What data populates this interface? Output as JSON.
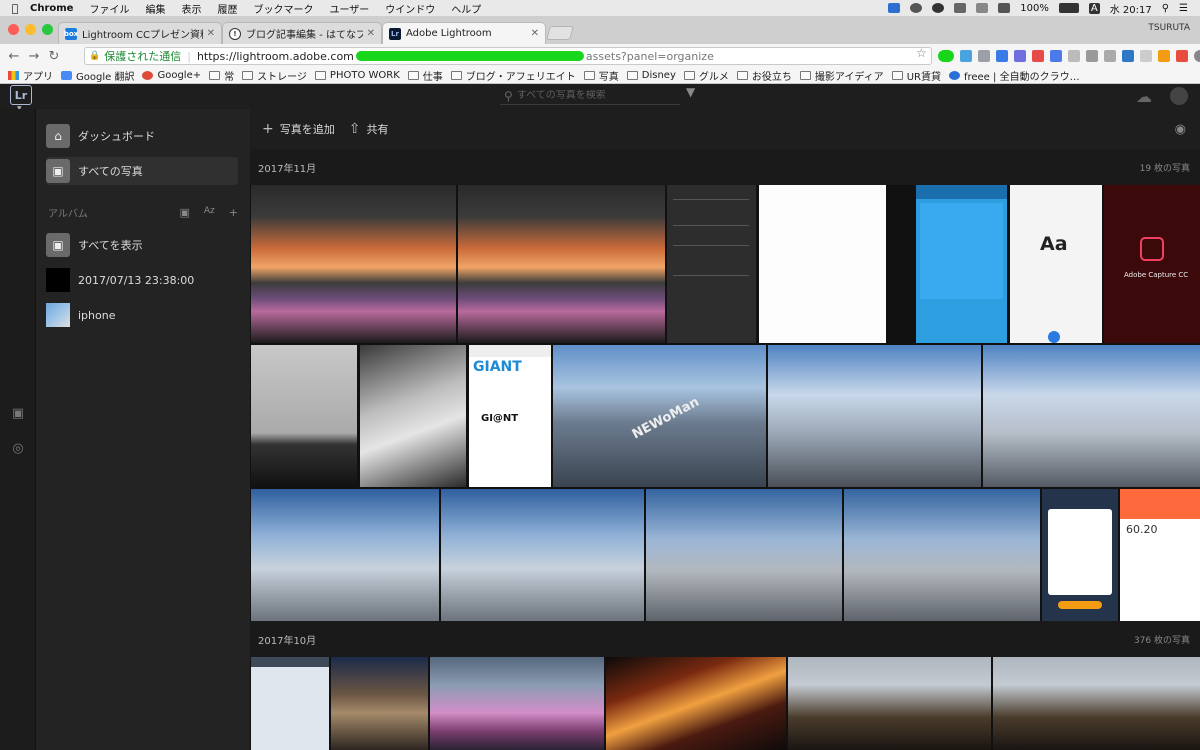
{
  "menubar": {
    "app": "Chrome",
    "items": [
      "ファイル",
      "編集",
      "表示",
      "履歴",
      "ブックマーク",
      "ユーザー",
      "ウインドウ",
      "ヘルプ"
    ],
    "battery": "100%",
    "input_mode": "A",
    "clock": "水 20:17"
  },
  "browser": {
    "tabs": [
      {
        "label": "Lightroom CCプレゼン資料.pdf",
        "favicon": "box",
        "active": false
      },
      {
        "label": "ブログ記事編集 - はてなブログ",
        "favicon": "hatena",
        "active": false
      },
      {
        "label": "Adobe Lightroom",
        "favicon": "Lr",
        "active": true
      }
    ],
    "profile_name": "TSURUTA",
    "address": {
      "secure_label": "保護された通信",
      "host": "https://lightroom.adobe.com",
      "path": "assets?panel=organize"
    },
    "bookmarks": [
      {
        "label": "アプリ",
        "icon": "apps-icon"
      },
      {
        "label": "Google 翻訳",
        "icon": "google-translate-icon"
      },
      {
        "label": "Google+",
        "icon": "google-plus-icon"
      },
      {
        "label": "常",
        "icon": "folder-icon"
      },
      {
        "label": "ストレージ",
        "icon": "folder-icon"
      },
      {
        "label": "PHOTO WORK",
        "icon": "folder-icon"
      },
      {
        "label": "仕事",
        "icon": "folder-icon"
      },
      {
        "label": "ブログ・アフェリエイト",
        "icon": "folder-icon"
      },
      {
        "label": "写真",
        "icon": "folder-icon"
      },
      {
        "label": "Disney",
        "icon": "folder-icon"
      },
      {
        "label": "グルメ",
        "icon": "folder-icon"
      },
      {
        "label": "お役立ち",
        "icon": "folder-icon"
      },
      {
        "label": "撮影アイディア",
        "icon": "folder-icon"
      },
      {
        "label": "UR賃貸",
        "icon": "folder-icon"
      },
      {
        "label": "freee | 全自動のクラウ…",
        "icon": "freee-icon"
      }
    ]
  },
  "app": {
    "logo": "Lr",
    "search_placeholder": "すべての写真を検索",
    "sidebar": {
      "dashboard": "ダッシュボード",
      "all_photos": "すべての写真",
      "albums_header": "アルバム",
      "sort_label": "Az",
      "show_all": "すべてを表示",
      "albums": [
        "2017/07/13 23:38:00",
        "iphone"
      ]
    },
    "toolbar": {
      "add_photos": "写真を追加",
      "share": "共有"
    },
    "sections": [
      {
        "title": "2017年11月",
        "count": "19 枚の写真"
      },
      {
        "title": "2017年10月",
        "count": "376 枚の写真"
      }
    ],
    "photo_text": {
      "capture_cc": "Adobe Capture CC",
      "type_sample": "Aa",
      "giant": "GIANT",
      "giant_bold": "GI@NT",
      "newoman": "NEWoMan",
      "health_value": "60.20"
    }
  },
  "colors": {
    "lr_bg": "#1e1e1e",
    "secure_green": "#1c8a32",
    "redaction": "#17d61c"
  }
}
